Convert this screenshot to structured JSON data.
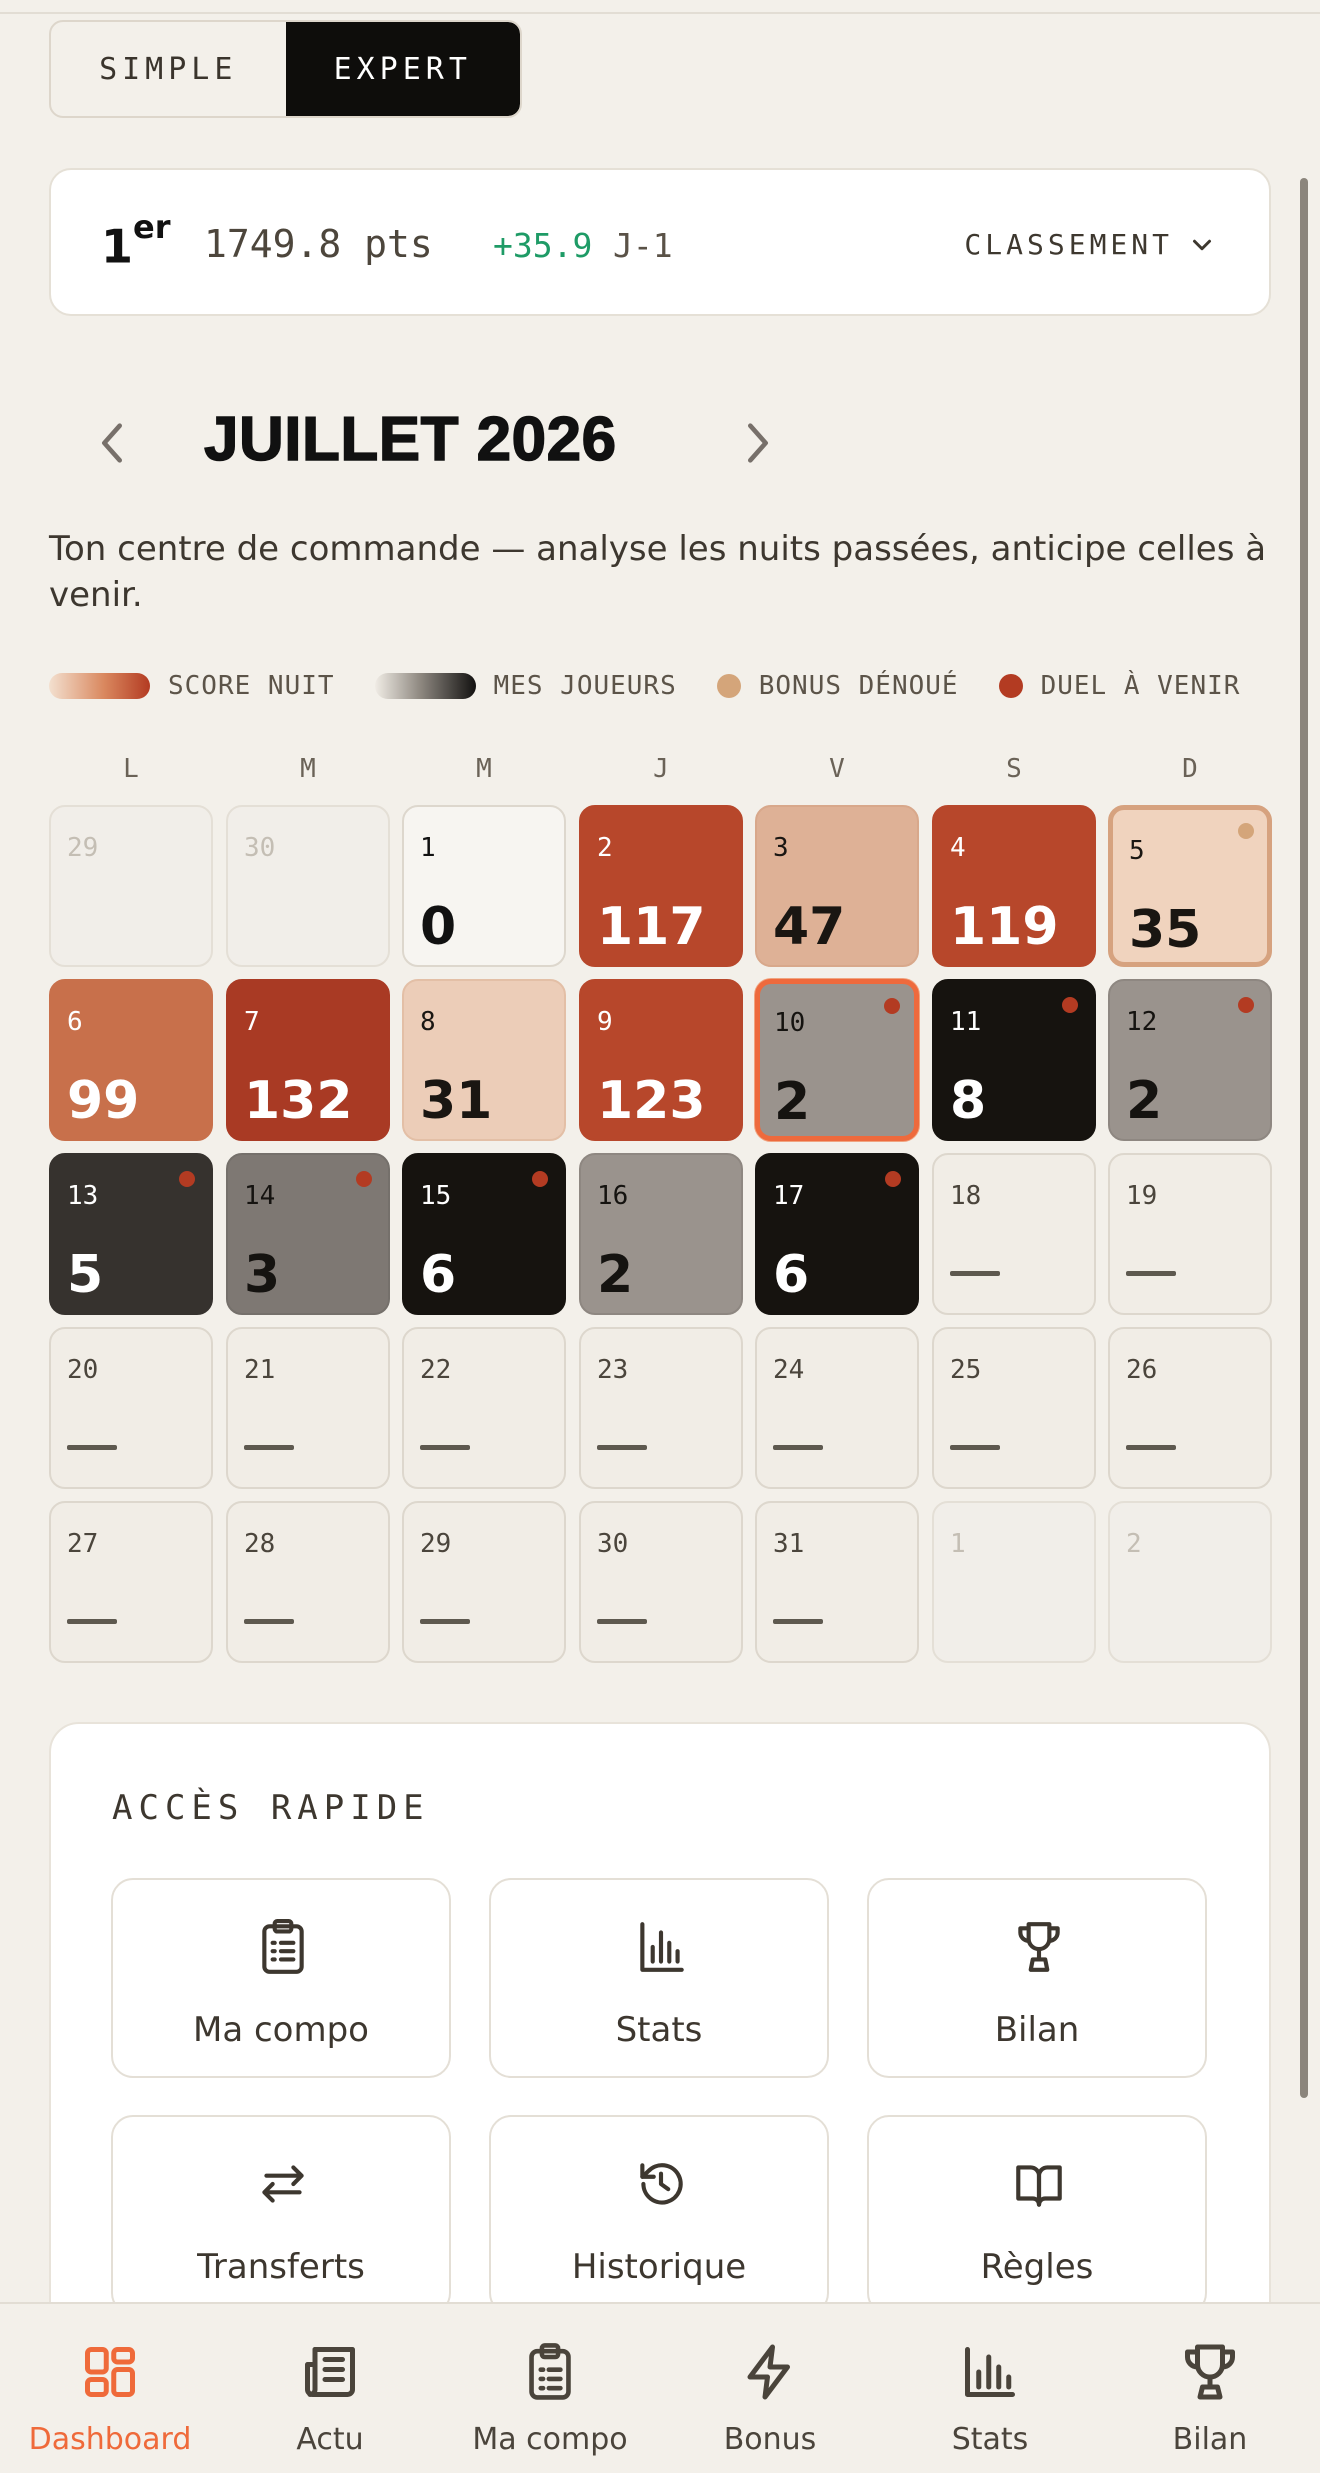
{
  "mode_toggle": {
    "simple_label": "SIMPLE",
    "expert_label": "EXPERT",
    "selected": "EXPERT"
  },
  "ranking": {
    "position": "1",
    "position_suffix": "er",
    "points": "1749.8 pts",
    "delta": "+35.9",
    "delta_period": "J-1",
    "dropdown_label": "CLASSEMENT",
    "delta_color": "#1e9b66"
  },
  "month_nav": {
    "title": "JUILLET 2026",
    "prev_icon": "chevron-left-icon",
    "next_icon": "chevron-right-icon"
  },
  "subtitle": "Ton centre de commande — analyse les nuits passées, anticipe celles à venir.",
  "legend": {
    "score_nuit": "SCORE NUIT",
    "mes_joueurs": "MES JOUEURS",
    "bonus_denoue": "BONUS DÉNOUÉ",
    "duel_a_venir": "DUEL À VENIR",
    "bonus_color": "#d4a57a",
    "duel_color": "#b33b22"
  },
  "calendar": {
    "weekdays": [
      "L",
      "M",
      "M",
      "J",
      "V",
      "S",
      "D"
    ],
    "cells": [
      {
        "day": "29",
        "value": "",
        "style": "out"
      },
      {
        "day": "30",
        "value": "",
        "style": "out"
      },
      {
        "day": "1",
        "value": "0",
        "style": "zero"
      },
      {
        "day": "2",
        "value": "117",
        "style": "s-strong"
      },
      {
        "day": "3",
        "value": "47",
        "style": "s-light"
      },
      {
        "day": "4",
        "value": "119",
        "style": "s-strong"
      },
      {
        "day": "5",
        "value": "35",
        "style": "bonus",
        "marker": true
      },
      {
        "day": "6",
        "value": "99",
        "style": "s-mid"
      },
      {
        "day": "7",
        "value": "132",
        "style": "s-deep"
      },
      {
        "day": "8",
        "value": "31",
        "style": "s-pale"
      },
      {
        "day": "9",
        "value": "123",
        "style": "s-strong"
      },
      {
        "day": "10",
        "value": "2",
        "style": "p-grey today",
        "marker": true
      },
      {
        "day": "11",
        "value": "8",
        "style": "p-black",
        "marker": true
      },
      {
        "day": "12",
        "value": "2",
        "style": "p-grey",
        "marker": true
      },
      {
        "day": "13",
        "value": "5",
        "style": "p-dark",
        "marker": true
      },
      {
        "day": "14",
        "value": "3",
        "style": "p-mid",
        "marker": true
      },
      {
        "day": "15",
        "value": "6",
        "style": "p-black",
        "marker": true
      },
      {
        "day": "16",
        "value": "2",
        "style": "p-grey"
      },
      {
        "day": "17",
        "value": "6",
        "style": "p-black",
        "marker": true
      },
      {
        "day": "18",
        "value": "—",
        "style": "empty"
      },
      {
        "day": "19",
        "value": "—",
        "style": "empty"
      },
      {
        "day": "20",
        "value": "—",
        "style": "empty"
      },
      {
        "day": "21",
        "value": "—",
        "style": "empty"
      },
      {
        "day": "22",
        "value": "—",
        "style": "empty"
      },
      {
        "day": "23",
        "value": "—",
        "style": "empty"
      },
      {
        "day": "24",
        "value": "—",
        "style": "empty"
      },
      {
        "day": "25",
        "value": "—",
        "style": "empty"
      },
      {
        "day": "26",
        "value": "—",
        "style": "empty"
      },
      {
        "day": "27",
        "value": "—",
        "style": "empty"
      },
      {
        "day": "28",
        "value": "—",
        "style": "empty"
      },
      {
        "day": "29",
        "value": "—",
        "style": "empty"
      },
      {
        "day": "30",
        "value": "—",
        "style": "empty"
      },
      {
        "day": "31",
        "value": "—",
        "style": "empty"
      },
      {
        "day": "1",
        "value": "",
        "style": "out"
      },
      {
        "day": "2",
        "value": "",
        "style": "out"
      }
    ]
  },
  "quick_access": {
    "title": "ACCÈS RAPIDE",
    "items": [
      {
        "label": "Ma compo",
        "icon": "clipboard-icon"
      },
      {
        "label": "Stats",
        "icon": "bar-chart-icon"
      },
      {
        "label": "Bilan",
        "icon": "trophy-icon"
      },
      {
        "label": "Transferts",
        "icon": "arrows-swap-icon"
      },
      {
        "label": "Historique",
        "icon": "history-icon"
      },
      {
        "label": "Règles",
        "icon": "book-icon"
      }
    ]
  },
  "bottom_nav": {
    "items": [
      {
        "label": "Dashboard",
        "icon": "dashboard-icon",
        "active": true
      },
      {
        "label": "Actu",
        "icon": "newspaper-icon"
      },
      {
        "label": "Ma compo",
        "icon": "clipboard-icon"
      },
      {
        "label": "Bonus",
        "icon": "lightning-icon"
      },
      {
        "label": "Stats",
        "icon": "bar-chart-icon"
      },
      {
        "label": "Bilan",
        "icon": "trophy-icon"
      }
    ],
    "active_color": "#ef6a3a"
  }
}
